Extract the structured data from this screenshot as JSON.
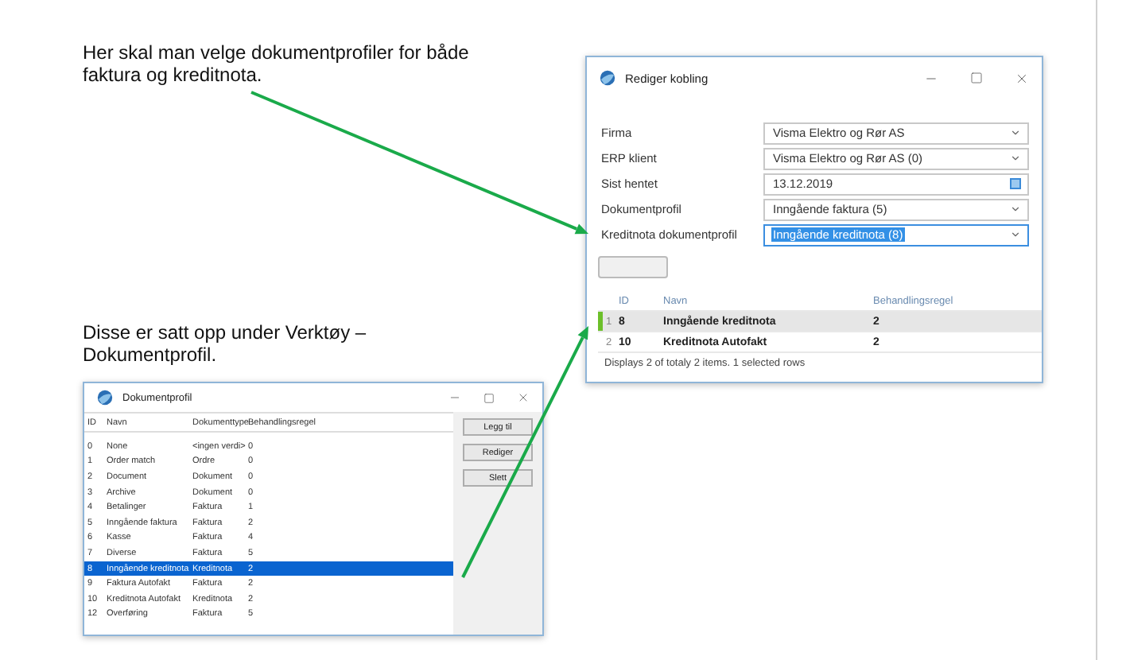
{
  "notes": [
    {
      "text": "Her skal man velge dokumentprofiler for både faktura og kreditnota."
    },
    {
      "text": "Disse er satt opp under Verktøy – Dokumentprofil."
    }
  ],
  "edit_window": {
    "title": "Rediger kobling",
    "fields": [
      {
        "label": "Firma",
        "value": "Visma Elektro og Rør AS",
        "kind": "dropdown",
        "selected": false
      },
      {
        "label": "ERP klient",
        "value": "Visma Elektro og Rør AS (0)",
        "kind": "dropdown",
        "selected": false
      },
      {
        "label": "Sist hentet",
        "value": "13.12.2019",
        "kind": "date",
        "selected": false
      },
      {
        "label": "Dokumentprofil",
        "value": "Inngående faktura (5)",
        "kind": "dropdown",
        "selected": false
      },
      {
        "label": "Kreditnota dokumentprofil",
        "value": "Inngående kreditnota (8)",
        "kind": "dropdown",
        "selected": true
      }
    ],
    "grid": {
      "columns": [
        "ID",
        "Navn",
        "Behandlingsregel"
      ],
      "rows": [
        {
          "number": "1",
          "cells": [
            "8",
            "Inngående kreditnota",
            "2"
          ],
          "selected": true
        },
        {
          "number": "2",
          "cells": [
            "10",
            "Kreditnota Autofakt",
            "2"
          ],
          "selected": false
        }
      ],
      "footer": "Displays 2 of totaly 2 items. 1 selected rows"
    }
  },
  "profile_window": {
    "title": "Dokumentprofil",
    "columns": [
      "ID",
      "Navn",
      "Dokumenttype",
      "Behandlingsregel"
    ],
    "rows": [
      {
        "cells": [
          "0",
          "None",
          "<ingen verdi>",
          "0"
        ],
        "selected": false
      },
      {
        "cells": [
          "1",
          "Order match",
          "Ordre",
          "0"
        ],
        "selected": false
      },
      {
        "cells": [
          "2",
          "Document",
          "Dokument",
          "0"
        ],
        "selected": false
      },
      {
        "cells": [
          "3",
          "Archive",
          "Dokument",
          "0"
        ],
        "selected": false
      },
      {
        "cells": [
          "4",
          "Betalinger",
          "Faktura",
          "1"
        ],
        "selected": false
      },
      {
        "cells": [
          "5",
          "Inngående faktura",
          "Faktura",
          "2"
        ],
        "selected": false
      },
      {
        "cells": [
          "6",
          "Kasse",
          "Faktura",
          "4"
        ],
        "selected": false
      },
      {
        "cells": [
          "7",
          "Diverse",
          "Faktura",
          "5"
        ],
        "selected": false
      },
      {
        "cells": [
          "8",
          "Inngående kreditnota",
          "Kreditnota",
          "2"
        ],
        "selected": true
      },
      {
        "cells": [
          "9",
          "Faktura Autofakt",
          "Faktura",
          "2"
        ],
        "selected": false
      },
      {
        "cells": [
          "10",
          "Kreditnota Autofakt",
          "Kreditnota",
          "2"
        ],
        "selected": false
      },
      {
        "cells": [
          "12",
          "Overføring",
          "Faktura",
          "5"
        ],
        "selected": false
      }
    ],
    "buttons": [
      "Legg til",
      "Rediger",
      "Slett"
    ]
  }
}
